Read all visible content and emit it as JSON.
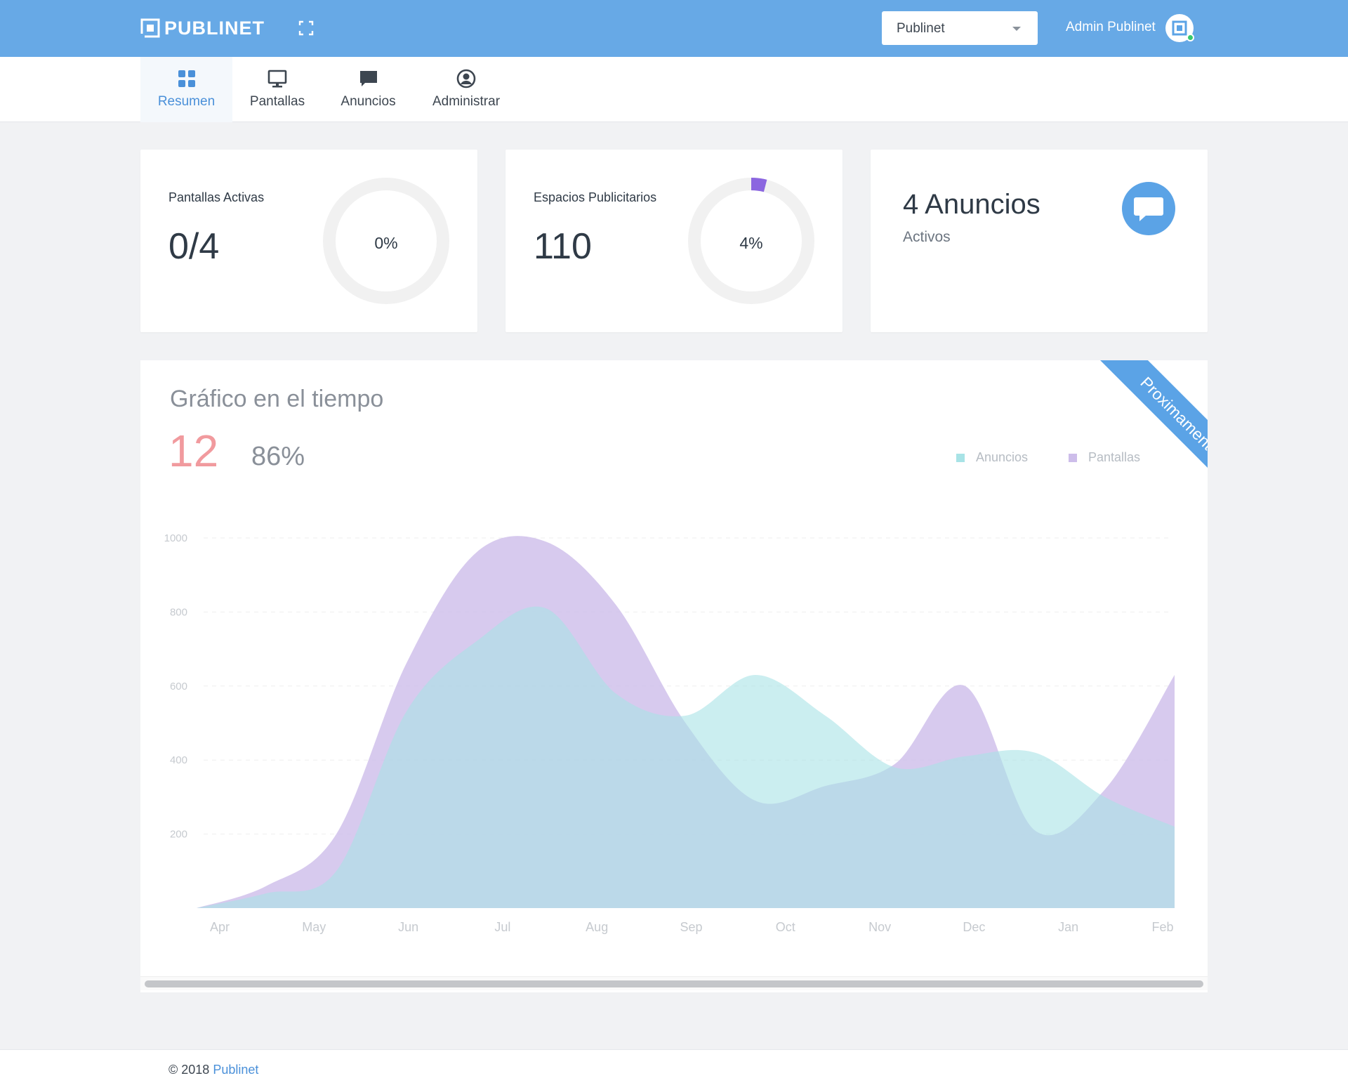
{
  "header": {
    "logo_text": "PUBLINET",
    "select_value": "Publinet",
    "user_name": "Admin Publinet"
  },
  "nav": {
    "tabs": [
      {
        "label": "Resumen",
        "icon": "grid-icon",
        "active": true
      },
      {
        "label": "Pantallas",
        "icon": "monitor-icon",
        "active": false
      },
      {
        "label": "Anuncios",
        "icon": "chat-icon",
        "active": false
      },
      {
        "label": "Administrar",
        "icon": "user-circle-icon",
        "active": false
      }
    ]
  },
  "cards": {
    "pantallas": {
      "label": "Pantallas Activas",
      "value": "0/4",
      "percent_label": "0%",
      "percent": 0
    },
    "espacios": {
      "label": "Espacios Publicitarios",
      "value": "110",
      "percent_label": "4%",
      "percent": 4
    },
    "anuncios": {
      "title": "4 Anuncios",
      "subtitle": "Activos"
    }
  },
  "chart_section": {
    "title": "Gráfico en el tiempo",
    "stat_primary": "12",
    "stat_secondary": "86%",
    "ribbon": "Proximamente"
  },
  "colors": {
    "topbar": "#67a9e6",
    "accent": "#4a90d9",
    "anuncios": "#a8e3e6",
    "pantallas": "#cdbdea",
    "stat_red": "#f19a9e"
  },
  "chart_data": {
    "type": "area",
    "categories": [
      "Apr",
      "May",
      "Jun",
      "Jul",
      "Aug",
      "Sep",
      "Oct",
      "Nov",
      "Dec",
      "Jan",
      "Feb"
    ],
    "x": [
      "Apr",
      "Apr-May",
      "May",
      "Jun",
      "Jun-Jul",
      "Jul",
      "Aug",
      "Sep",
      "Oct",
      "Oct-Nov",
      "Nov",
      "Dec",
      "Dec-Jan",
      "Jan",
      "Feb"
    ],
    "series": [
      {
        "name": "Anuncios",
        "values": [
          0,
          40,
          100,
          530,
          720,
          810,
          580,
          520,
          630,
          520,
          380,
          410,
          420,
          300,
          220
        ]
      },
      {
        "name": "Pantallas",
        "values": [
          0,
          60,
          200,
          660,
          960,
          990,
          820,
          500,
          290,
          330,
          390,
          600,
          210,
          320,
          630
        ]
      }
    ],
    "yticks": [
      1000,
      800,
      600,
      400,
      200
    ],
    "ylim": [
      0,
      1000
    ],
    "legend_position": "top-right",
    "grid": true
  },
  "footer": {
    "copyright": "© 2018",
    "link": "Publinet"
  }
}
